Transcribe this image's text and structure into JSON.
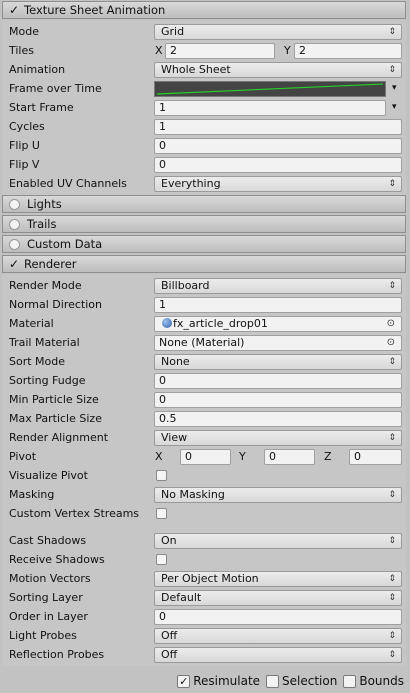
{
  "texture_sheet": {
    "header": "Texture Sheet Animation",
    "mode": {
      "label": "Mode",
      "value": "Grid"
    },
    "tiles": {
      "label": "Tiles",
      "x_label": "X",
      "x": "2",
      "y_label": "Y",
      "y": "2"
    },
    "animation": {
      "label": "Animation",
      "value": "Whole Sheet"
    },
    "frame_over_time": {
      "label": "Frame over Time"
    },
    "start_frame": {
      "label": "Start Frame",
      "value": "1"
    },
    "cycles": {
      "label": "Cycles",
      "value": "1"
    },
    "flip_u": {
      "label": "Flip U",
      "value": "0"
    },
    "flip_v": {
      "label": "Flip V",
      "value": "0"
    },
    "uv_channels": {
      "label": "Enabled UV Channels",
      "value": "Everything"
    }
  },
  "collapsed": {
    "lights": "Lights",
    "trails": "Trails",
    "custom_data": "Custom Data"
  },
  "renderer": {
    "header": "Renderer",
    "render_mode": {
      "label": "Render Mode",
      "value": "Billboard"
    },
    "normal_direction": {
      "label": "Normal Direction",
      "value": "1"
    },
    "material": {
      "label": "Material",
      "value": "fx_article_drop01"
    },
    "trail_material": {
      "label": "Trail Material",
      "value": "None (Material)"
    },
    "sort_mode": {
      "label": "Sort Mode",
      "value": "None"
    },
    "sorting_fudge": {
      "label": "Sorting Fudge",
      "value": "0"
    },
    "min_particle_size": {
      "label": "Min Particle Size",
      "value": "0"
    },
    "max_particle_size": {
      "label": "Max Particle Size",
      "value": "0.5"
    },
    "render_alignment": {
      "label": "Render Alignment",
      "value": "View"
    },
    "pivot": {
      "label": "Pivot",
      "x_label": "X",
      "x": "0",
      "y_label": "Y",
      "y": "0",
      "z_label": "Z",
      "z": "0"
    },
    "visualize_pivot": {
      "label": "Visualize Pivot"
    },
    "masking": {
      "label": "Masking",
      "value": "No Masking"
    },
    "custom_vertex_streams": {
      "label": "Custom Vertex Streams"
    },
    "cast_shadows": {
      "label": "Cast Shadows",
      "value": "On"
    },
    "receive_shadows": {
      "label": "Receive Shadows"
    },
    "motion_vectors": {
      "label": "Motion Vectors",
      "value": "Per Object Motion"
    },
    "sorting_layer": {
      "label": "Sorting Layer",
      "value": "Default"
    },
    "order_in_layer": {
      "label": "Order in Layer",
      "value": "0"
    },
    "light_probes": {
      "label": "Light Probes",
      "value": "Off"
    },
    "reflection_probes": {
      "label": "Reflection Probes",
      "value": "Off"
    }
  },
  "footer": {
    "resimulate": "Resimulate",
    "selection": "Selection",
    "bounds": "Bounds"
  },
  "icons": {
    "check": "✓",
    "dropdown_arrow": "⇕",
    "dropdown_small": "▾",
    "target": "⊙"
  }
}
